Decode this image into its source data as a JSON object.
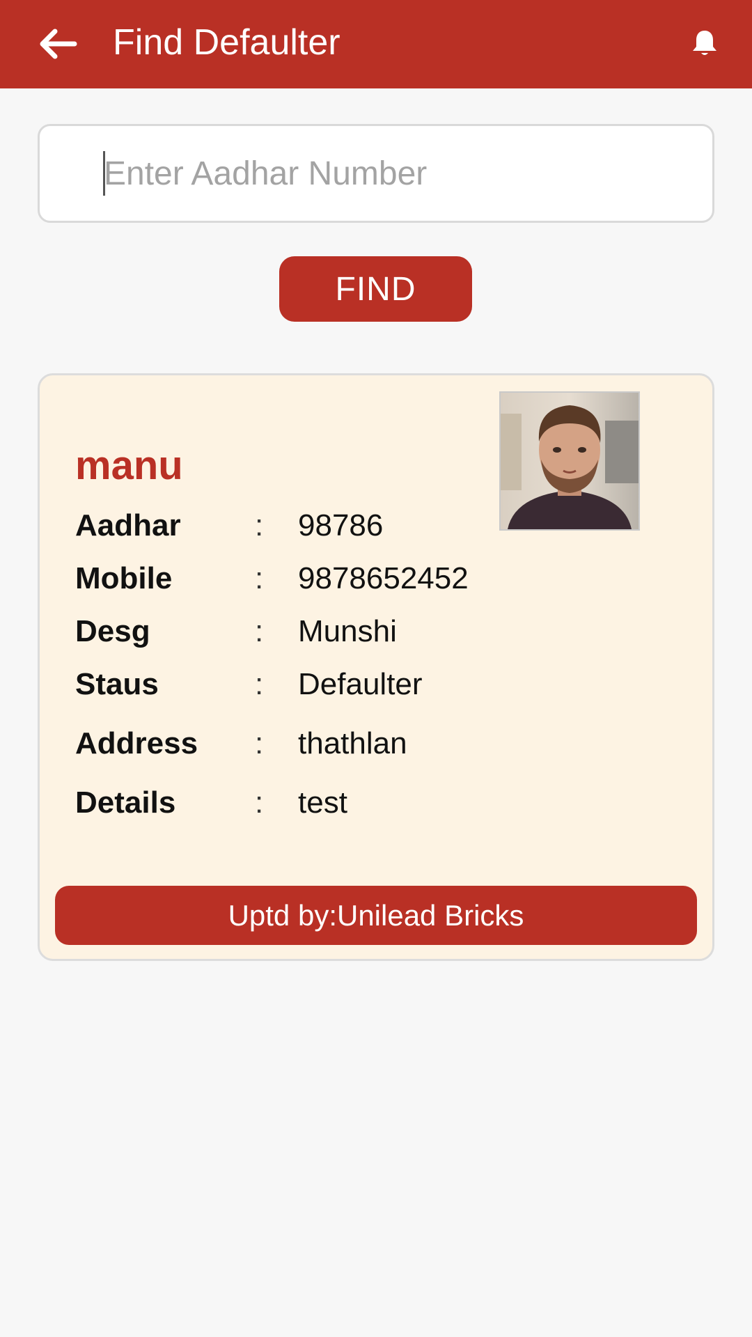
{
  "appbar": {
    "title": "Find Defaulter",
    "back_icon": "arrow-left-icon",
    "bell_icon": "bell-icon",
    "background_color": "#b93025"
  },
  "search": {
    "placeholder": "Enter Aadhar Number",
    "value": ""
  },
  "find_button": {
    "label": "FIND"
  },
  "result_card": {
    "name": "manu",
    "photo_icon": "person-photo",
    "fields": [
      {
        "label": "Aadhar",
        "value": "98786"
      },
      {
        "label": "Mobile",
        "value": "9878652452"
      },
      {
        "label": "Desg",
        "value": "Munshi"
      },
      {
        "label": "Staus",
        "value": "Defaulter"
      },
      {
        "label": "Address",
        "value": "thathlan"
      },
      {
        "label": "Details",
        "value": "test"
      }
    ],
    "separator": ":",
    "updated_by": "Uptd by:Unilead Bricks",
    "background_color": "#fdf3e3"
  }
}
